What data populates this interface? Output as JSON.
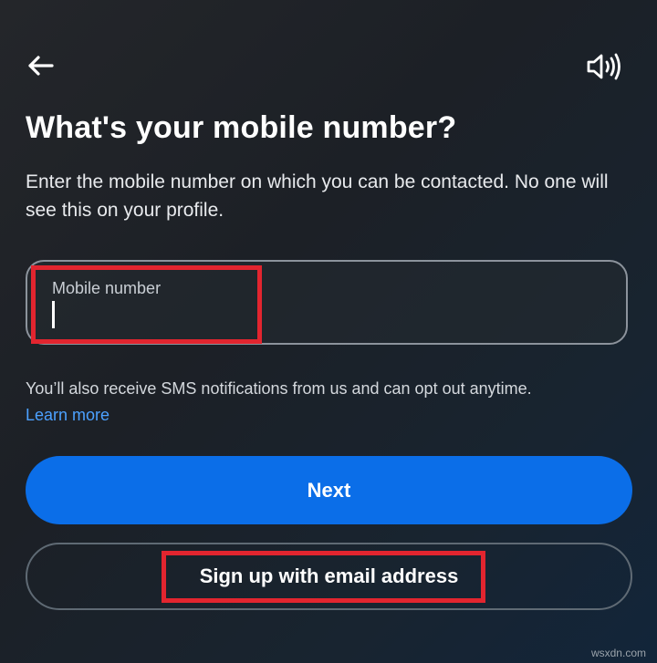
{
  "header": {
    "back_icon": "back-arrow-icon",
    "sound_icon": "speaker-icon"
  },
  "title": "What's your mobile number?",
  "subtitle": "Enter the mobile number on which you can be contacted. No one will see this on your profile.",
  "mobile_input": {
    "label": "Mobile number",
    "value": ""
  },
  "notice": "You’ll also receive SMS notifications from us and can opt out anytime.",
  "learn_more": "Learn more",
  "buttons": {
    "next": "Next",
    "email_signup": "Sign up with email address"
  },
  "watermark": "wsxdn.com",
  "colors": {
    "primary": "#0b6ee8",
    "link": "#4ca1ff",
    "highlight": "#e2252f"
  }
}
